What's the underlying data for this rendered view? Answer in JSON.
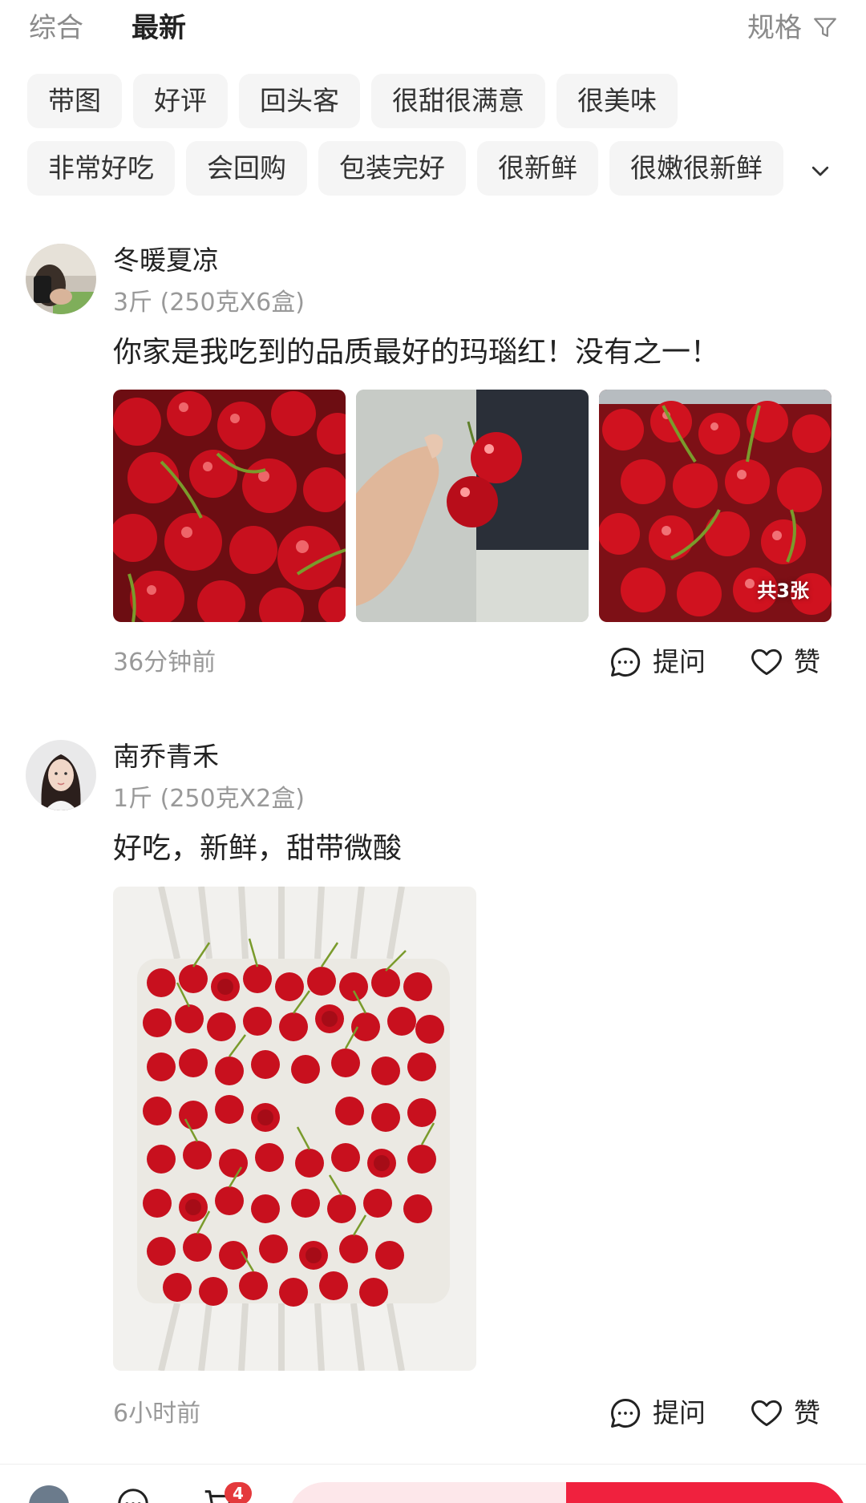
{
  "sort_tabs": [
    {
      "label": "综合",
      "active": false
    },
    {
      "label": "最新",
      "active": true
    }
  ],
  "spec_filter": {
    "label": "规格",
    "icon": "filter-icon"
  },
  "tags": {
    "row1": [
      "带图",
      "好评",
      "回头客",
      "很甜很满意",
      "很美味"
    ],
    "row2": [
      "非常好吃",
      "会回购",
      "包装完好",
      "很新鲜",
      "很嫩很新鲜"
    ],
    "expand_icon": "chevron-down-icon"
  },
  "reviews": [
    {
      "name": "冬暖夏凉",
      "spec": "3斤 (250克X6盒)",
      "text": "你家是我吃到的品质最好的玛瑙红！没有之一！",
      "photo_count_label": "共3张",
      "time": "36分钟前",
      "ask_label": "提问",
      "like_label": "赞"
    },
    {
      "name": "南乔青禾",
      "spec": "1斤 (250克X2盒)",
      "text": "好吃，新鲜，甜带微酸",
      "time": "6小时前",
      "ask_label": "提问",
      "like_label": "赞"
    }
  ],
  "bottom_bar": {
    "cart_badge": "4"
  },
  "colors": {
    "accent_red": "#f0213e",
    "tag_bg": "#f5f5f5",
    "muted_text": "#999999"
  }
}
